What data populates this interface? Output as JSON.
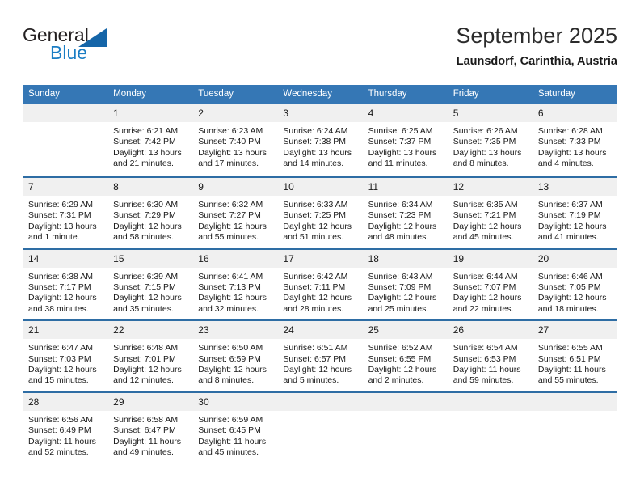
{
  "logo": {
    "word1": "General",
    "word2": "Blue",
    "triangle_color": "#1565a8",
    "blue_color": "#1a7dc4"
  },
  "header": {
    "month_title": "September 2025",
    "location": "Launsdorf, Carinthia, Austria"
  },
  "theme": {
    "header_bg": "#3577b5",
    "row_divider": "#2e6da4",
    "daynum_bg": "#f0f0f0"
  },
  "weekday_headers": [
    "Sunday",
    "Monday",
    "Tuesday",
    "Wednesday",
    "Thursday",
    "Friday",
    "Saturday"
  ],
  "weeks": [
    [
      {
        "day": "",
        "sunrise": "",
        "sunset": "",
        "daylight": ""
      },
      {
        "day": "1",
        "sunrise": "Sunrise: 6:21 AM",
        "sunset": "Sunset: 7:42 PM",
        "daylight": "Daylight: 13 hours and 21 minutes."
      },
      {
        "day": "2",
        "sunrise": "Sunrise: 6:23 AM",
        "sunset": "Sunset: 7:40 PM",
        "daylight": "Daylight: 13 hours and 17 minutes."
      },
      {
        "day": "3",
        "sunrise": "Sunrise: 6:24 AM",
        "sunset": "Sunset: 7:38 PM",
        "daylight": "Daylight: 13 hours and 14 minutes."
      },
      {
        "day": "4",
        "sunrise": "Sunrise: 6:25 AM",
        "sunset": "Sunset: 7:37 PM",
        "daylight": "Daylight: 13 hours and 11 minutes."
      },
      {
        "day": "5",
        "sunrise": "Sunrise: 6:26 AM",
        "sunset": "Sunset: 7:35 PM",
        "daylight": "Daylight: 13 hours and 8 minutes."
      },
      {
        "day": "6",
        "sunrise": "Sunrise: 6:28 AM",
        "sunset": "Sunset: 7:33 PM",
        "daylight": "Daylight: 13 hours and 4 minutes."
      }
    ],
    [
      {
        "day": "7",
        "sunrise": "Sunrise: 6:29 AM",
        "sunset": "Sunset: 7:31 PM",
        "daylight": "Daylight: 13 hours and 1 minute."
      },
      {
        "day": "8",
        "sunrise": "Sunrise: 6:30 AM",
        "sunset": "Sunset: 7:29 PM",
        "daylight": "Daylight: 12 hours and 58 minutes."
      },
      {
        "day": "9",
        "sunrise": "Sunrise: 6:32 AM",
        "sunset": "Sunset: 7:27 PM",
        "daylight": "Daylight: 12 hours and 55 minutes."
      },
      {
        "day": "10",
        "sunrise": "Sunrise: 6:33 AM",
        "sunset": "Sunset: 7:25 PM",
        "daylight": "Daylight: 12 hours and 51 minutes."
      },
      {
        "day": "11",
        "sunrise": "Sunrise: 6:34 AM",
        "sunset": "Sunset: 7:23 PM",
        "daylight": "Daylight: 12 hours and 48 minutes."
      },
      {
        "day": "12",
        "sunrise": "Sunrise: 6:35 AM",
        "sunset": "Sunset: 7:21 PM",
        "daylight": "Daylight: 12 hours and 45 minutes."
      },
      {
        "day": "13",
        "sunrise": "Sunrise: 6:37 AM",
        "sunset": "Sunset: 7:19 PM",
        "daylight": "Daylight: 12 hours and 41 minutes."
      }
    ],
    [
      {
        "day": "14",
        "sunrise": "Sunrise: 6:38 AM",
        "sunset": "Sunset: 7:17 PM",
        "daylight": "Daylight: 12 hours and 38 minutes."
      },
      {
        "day": "15",
        "sunrise": "Sunrise: 6:39 AM",
        "sunset": "Sunset: 7:15 PM",
        "daylight": "Daylight: 12 hours and 35 minutes."
      },
      {
        "day": "16",
        "sunrise": "Sunrise: 6:41 AM",
        "sunset": "Sunset: 7:13 PM",
        "daylight": "Daylight: 12 hours and 32 minutes."
      },
      {
        "day": "17",
        "sunrise": "Sunrise: 6:42 AM",
        "sunset": "Sunset: 7:11 PM",
        "daylight": "Daylight: 12 hours and 28 minutes."
      },
      {
        "day": "18",
        "sunrise": "Sunrise: 6:43 AM",
        "sunset": "Sunset: 7:09 PM",
        "daylight": "Daylight: 12 hours and 25 minutes."
      },
      {
        "day": "19",
        "sunrise": "Sunrise: 6:44 AM",
        "sunset": "Sunset: 7:07 PM",
        "daylight": "Daylight: 12 hours and 22 minutes."
      },
      {
        "day": "20",
        "sunrise": "Sunrise: 6:46 AM",
        "sunset": "Sunset: 7:05 PM",
        "daylight": "Daylight: 12 hours and 18 minutes."
      }
    ],
    [
      {
        "day": "21",
        "sunrise": "Sunrise: 6:47 AM",
        "sunset": "Sunset: 7:03 PM",
        "daylight": "Daylight: 12 hours and 15 minutes."
      },
      {
        "day": "22",
        "sunrise": "Sunrise: 6:48 AM",
        "sunset": "Sunset: 7:01 PM",
        "daylight": "Daylight: 12 hours and 12 minutes."
      },
      {
        "day": "23",
        "sunrise": "Sunrise: 6:50 AM",
        "sunset": "Sunset: 6:59 PM",
        "daylight": "Daylight: 12 hours and 8 minutes."
      },
      {
        "day": "24",
        "sunrise": "Sunrise: 6:51 AM",
        "sunset": "Sunset: 6:57 PM",
        "daylight": "Daylight: 12 hours and 5 minutes."
      },
      {
        "day": "25",
        "sunrise": "Sunrise: 6:52 AM",
        "sunset": "Sunset: 6:55 PM",
        "daylight": "Daylight: 12 hours and 2 minutes."
      },
      {
        "day": "26",
        "sunrise": "Sunrise: 6:54 AM",
        "sunset": "Sunset: 6:53 PM",
        "daylight": "Daylight: 11 hours and 59 minutes."
      },
      {
        "day": "27",
        "sunrise": "Sunrise: 6:55 AM",
        "sunset": "Sunset: 6:51 PM",
        "daylight": "Daylight: 11 hours and 55 minutes."
      }
    ],
    [
      {
        "day": "28",
        "sunrise": "Sunrise: 6:56 AM",
        "sunset": "Sunset: 6:49 PM",
        "daylight": "Daylight: 11 hours and 52 minutes."
      },
      {
        "day": "29",
        "sunrise": "Sunrise: 6:58 AM",
        "sunset": "Sunset: 6:47 PM",
        "daylight": "Daylight: 11 hours and 49 minutes."
      },
      {
        "day": "30",
        "sunrise": "Sunrise: 6:59 AM",
        "sunset": "Sunset: 6:45 PM",
        "daylight": "Daylight: 11 hours and 45 minutes."
      },
      {
        "day": "",
        "sunrise": "",
        "sunset": "",
        "daylight": ""
      },
      {
        "day": "",
        "sunrise": "",
        "sunset": "",
        "daylight": ""
      },
      {
        "day": "",
        "sunrise": "",
        "sunset": "",
        "daylight": ""
      },
      {
        "day": "",
        "sunrise": "",
        "sunset": "",
        "daylight": ""
      }
    ]
  ]
}
